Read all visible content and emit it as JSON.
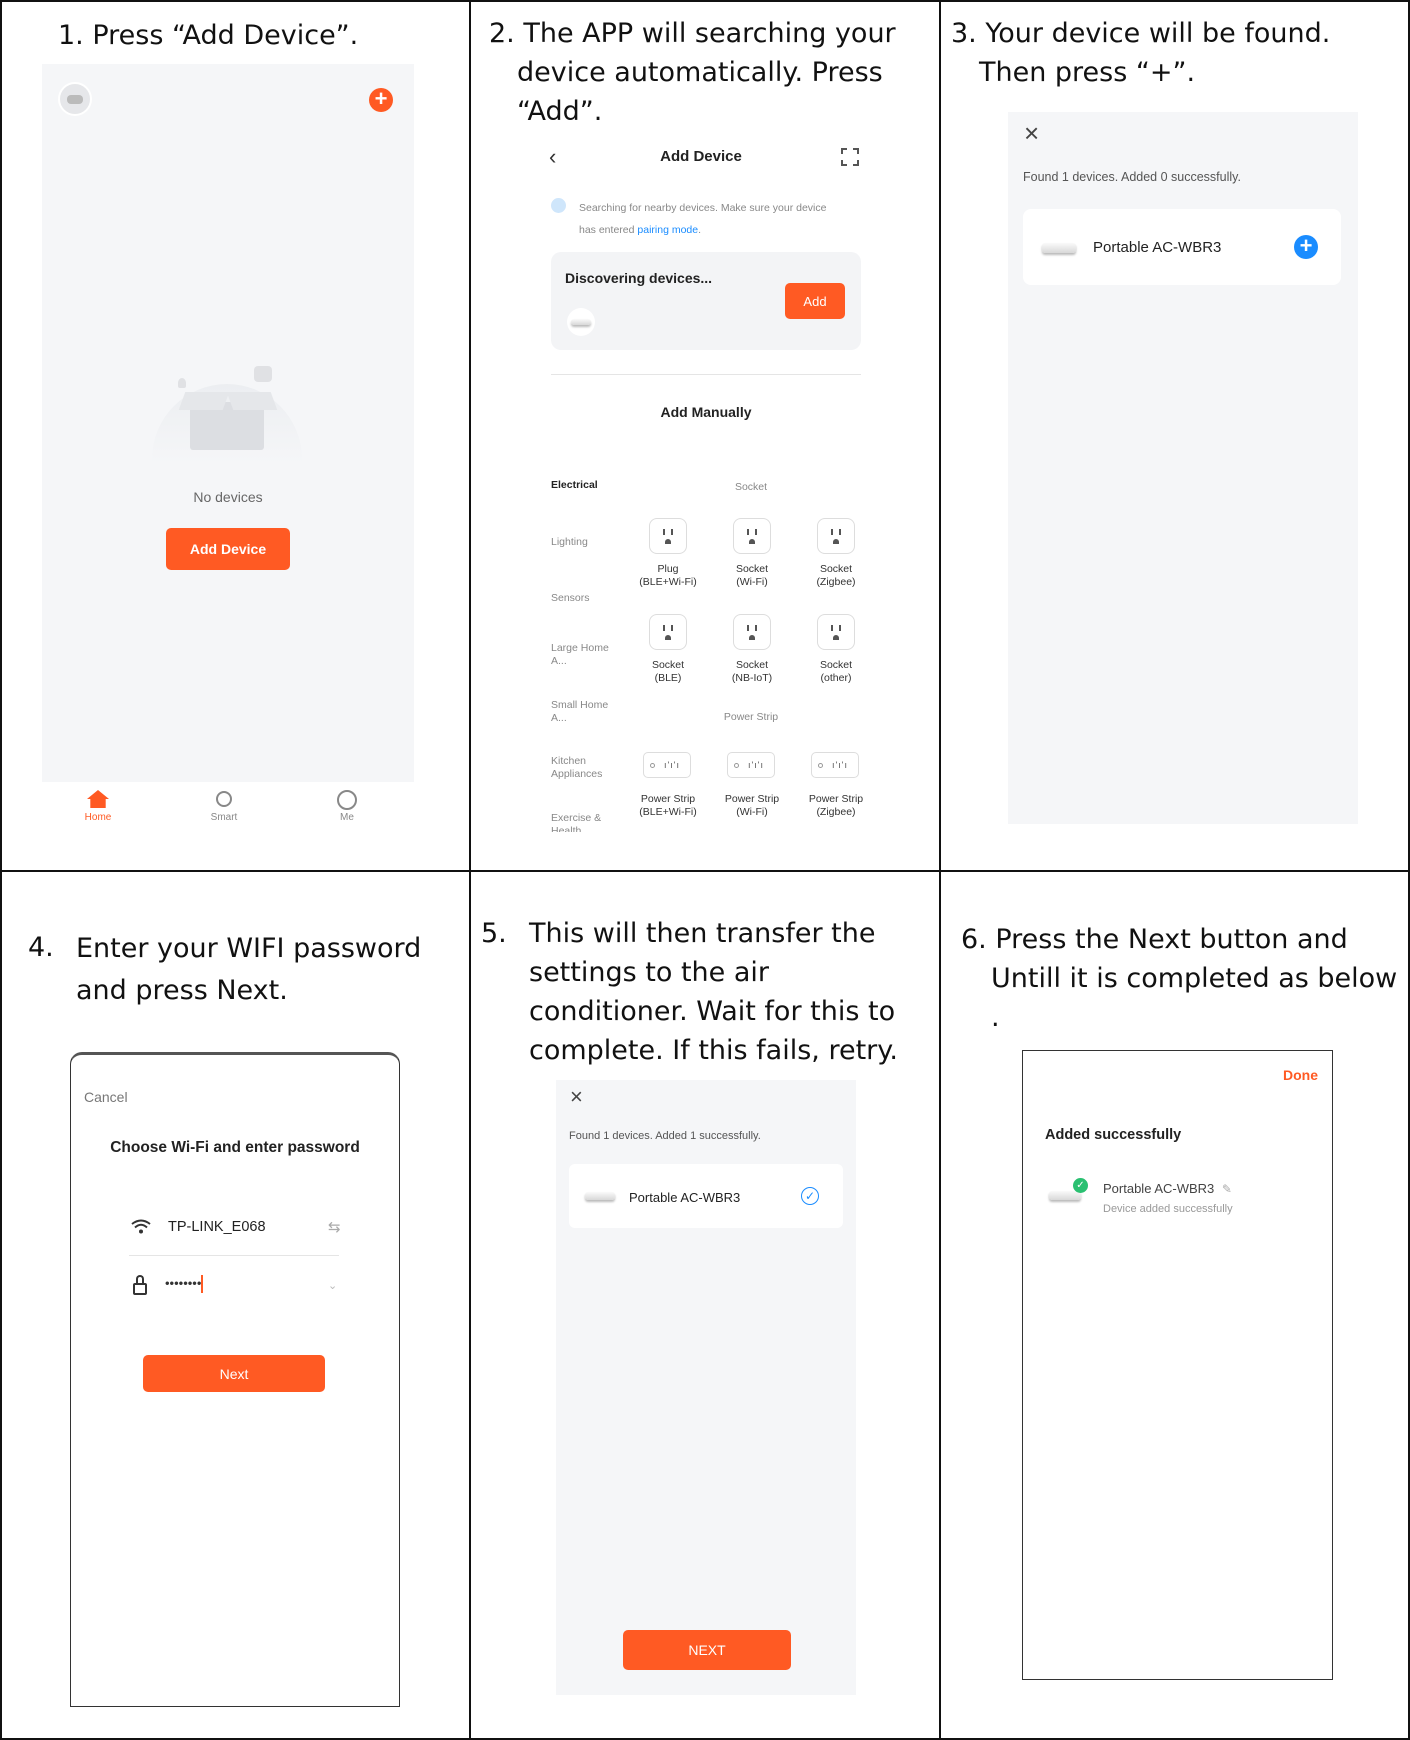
{
  "steps": {
    "s1": {
      "caption": "1. Press “Add Device”.",
      "no_devices": "No devices",
      "add_device_button": "Add Device",
      "tabs": [
        "Home",
        "Smart",
        "Me"
      ]
    },
    "s2": {
      "caption": "2. The APP will searching your device automatically. Press “Add”.",
      "title": "Add Device",
      "searching_text": "Searching for nearby devices. Make sure your device",
      "searching_text2": "has entered",
      "pairing_link": "pairing mode",
      "discovering": "Discovering devices...",
      "add_button": "Add",
      "add_manually": "Add Manually",
      "categories": [
        "Electrical",
        "Lighting",
        "Sensors",
        "Large Home A...",
        "Small Home A...",
        "Kitchen Appliances",
        "Exercise & Health"
      ],
      "section_socket": "Socket",
      "sockets": [
        {
          "line1": "Plug",
          "line2": "(BLE+Wi-Fi)"
        },
        {
          "line1": "Socket",
          "line2": "(Wi-Fi)"
        },
        {
          "line1": "Socket",
          "line2": "(Zigbee)"
        },
        {
          "line1": "Socket",
          "line2": "(BLE)"
        },
        {
          "line1": "Socket",
          "line2": "(NB-IoT)"
        },
        {
          "line1": "Socket",
          "line2": "(other)"
        }
      ],
      "section_strip": "Power Strip",
      "strips": [
        {
          "line1": "Power Strip",
          "line2": "(BLE+Wi-Fi)"
        },
        {
          "line1": "Power Strip",
          "line2": "(Wi-Fi)"
        },
        {
          "line1": "Power Strip",
          "line2": "(Zigbee)"
        }
      ]
    },
    "s3": {
      "caption": "3. Your device will be found. Then press “+”.",
      "found_text": "Found 1 devices. Added 0 successfully.",
      "device_name": "Portable AC-WBR3"
    },
    "s4": {
      "caption_num": "4.",
      "caption": "Enter your WIFI password and press Next.",
      "cancel": "Cancel",
      "title": "Choose Wi-Fi and enter password",
      "ssid": "TP-LINK_E068",
      "password": "••••••••",
      "next_button": "Next"
    },
    "s5": {
      "caption_num": "5.",
      "caption": "This will then transfer the settings to the air conditioner. Wait for this to complete. If this fails, retry.",
      "found_text": "Found 1 devices. Added 1 successfully.",
      "device_name": "Portable AC-WBR3",
      "next_button": "NEXT"
    },
    "s6": {
      "caption": "6. Press  the Next button and Untill it is completed as below .",
      "done": "Done",
      "added": "Added successfully",
      "device_name": "Portable AC-WBR3",
      "device_status": "Device added successfully"
    }
  }
}
